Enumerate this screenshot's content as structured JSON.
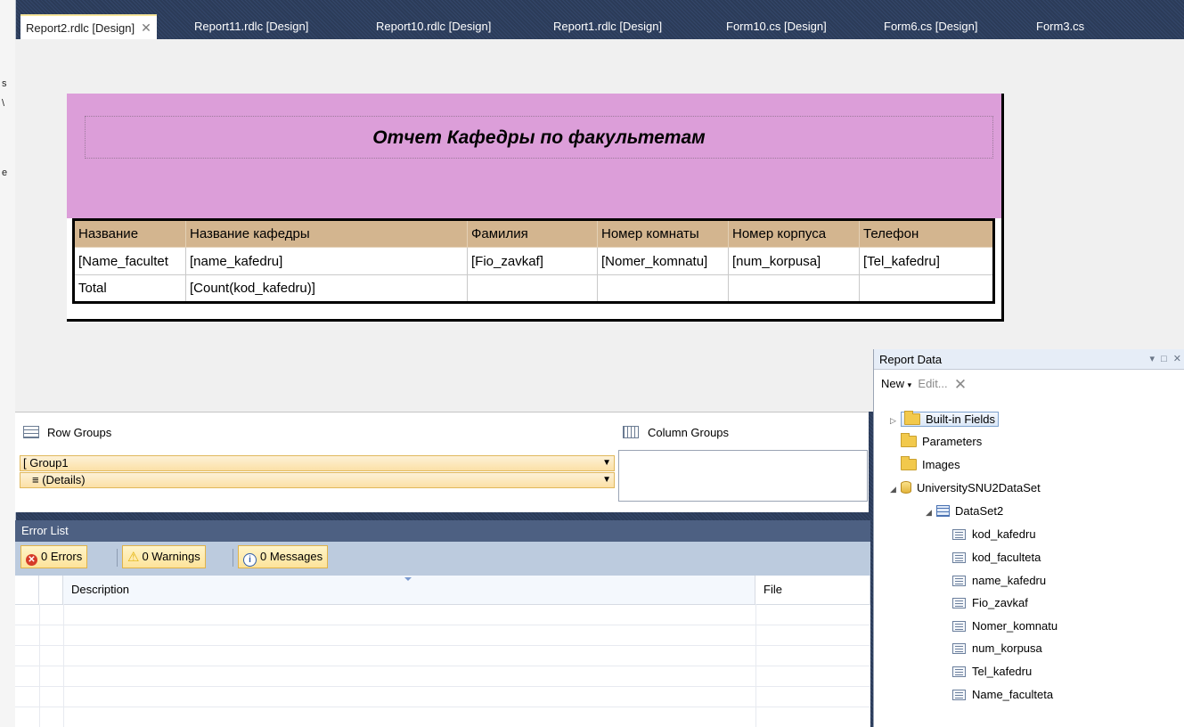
{
  "tabs": [
    {
      "label": "Report2.rdlc [Design]",
      "active": true
    },
    {
      "label": "Report11.rdlc [Design]"
    },
    {
      "label": "Report10.rdlc [Design]"
    },
    {
      "label": "Report1.rdlc [Design]"
    },
    {
      "label": "Form10.cs [Design]"
    },
    {
      "label": "Form6.cs [Design]"
    },
    {
      "label": "Form3.cs"
    }
  ],
  "left_strip": [
    "s",
    "\\",
    "e"
  ],
  "report": {
    "title": "Отчет Кафедры по факультетам",
    "header_color": "#dc9ed9",
    "columns": [
      "Название",
      "Название кафедры",
      "Фамилия",
      "Номер комнаты",
      "Номер корпуса",
      "Телефон"
    ],
    "detail_row": [
      "[Name_facultet",
      "[name_kafedru]",
      "[Fio_zavkaf]",
      "[Nomer_komnatu]",
      "[num_korpusa]",
      "[Tel_kafedru]"
    ],
    "total_row": [
      "Total",
      "[Count(kod_kafedru)]",
      "",
      "",
      "",
      ""
    ]
  },
  "grouping": {
    "row_groups_label": "Row Groups",
    "column_groups_label": "Column Groups",
    "row_groups": [
      {
        "label": "[ Group1"
      },
      {
        "label": "≡ (Details)"
      }
    ]
  },
  "error_list": {
    "title": "Error List",
    "errors": "0 Errors",
    "warnings": "0 Warnings",
    "messages": "0 Messages",
    "columns": [
      "Description",
      "File"
    ]
  },
  "report_data": {
    "title": "Report Data",
    "controls": "▾ □ ✕",
    "new_label": "New",
    "edit_label": "Edit...",
    "tree": {
      "builtin": "Built-in Fields",
      "parameters": "Parameters",
      "images": "Images",
      "dataset_source": "UniversitySNU2DataSet",
      "dataset": "DataSet2",
      "fields": [
        "kod_kafedru",
        "kod_faculteta",
        "name_kafedru",
        "Fio_zavkaf",
        "Nomer_komnatu",
        "num_korpusa",
        "Tel_kafedru",
        "Name_faculteta"
      ]
    }
  }
}
